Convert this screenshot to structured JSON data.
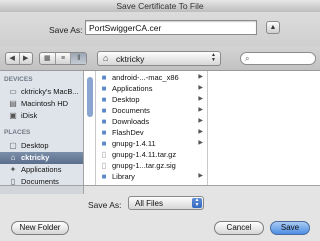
{
  "window": {
    "title": "Save Certificate To File"
  },
  "save_as": {
    "label": "Save As:",
    "value": "PortSwiggerCA.cer",
    "collapse_glyph": "▲"
  },
  "toolbar": {
    "back_glyph": "◀",
    "forward_glyph": "▶",
    "view_icons": [
      "▦",
      "≡",
      "‖"
    ],
    "path_glyph": "⌂",
    "path": "cktricky",
    "search_glyph": "⌕"
  },
  "sidebar": {
    "devices_header": "DEVICES",
    "devices": [
      {
        "label": "cktricky's MacB...",
        "icon": "laptop-icon",
        "glyph": "▭"
      },
      {
        "label": "Macintosh HD",
        "icon": "harddrive-icon",
        "glyph": "▤"
      },
      {
        "label": "iDisk",
        "icon": "idisk-icon",
        "glyph": "▣"
      }
    ],
    "places_header": "PLACES",
    "places": [
      {
        "label": "Desktop",
        "icon": "desktop-icon",
        "glyph": "▢",
        "selected": false
      },
      {
        "label": "cktricky",
        "icon": "home-icon",
        "glyph": "⌂",
        "selected": true
      },
      {
        "label": "Applications",
        "icon": "applications-icon",
        "glyph": "✦",
        "selected": false
      },
      {
        "label": "Documents",
        "icon": "documents-icon",
        "glyph": "▯",
        "selected": false
      }
    ]
  },
  "files": [
    {
      "name": "android-...-mac_x86",
      "kind": "folder",
      "chevron": true
    },
    {
      "name": "Applications",
      "kind": "folder",
      "chevron": true
    },
    {
      "name": "Desktop",
      "kind": "folder",
      "chevron": true
    },
    {
      "name": "Documents",
      "kind": "folder",
      "chevron": true
    },
    {
      "name": "Downloads",
      "kind": "folder",
      "chevron": true
    },
    {
      "name": "FlashDev",
      "kind": "folder",
      "chevron": true
    },
    {
      "name": "gnupg-1.4.11",
      "kind": "folder",
      "chevron": true
    },
    {
      "name": "gnupg-1.4.11.tar.gz",
      "kind": "file",
      "chevron": false
    },
    {
      "name": "gnupg-1...tar.gz.sig",
      "kind": "file",
      "chevron": false
    },
    {
      "name": "Library",
      "kind": "folder",
      "chevron": true
    }
  ],
  "format": {
    "label": "Save As:",
    "value": "All Files"
  },
  "buttons": {
    "new_folder": "New Folder",
    "cancel": "Cancel",
    "save": "Save"
  }
}
